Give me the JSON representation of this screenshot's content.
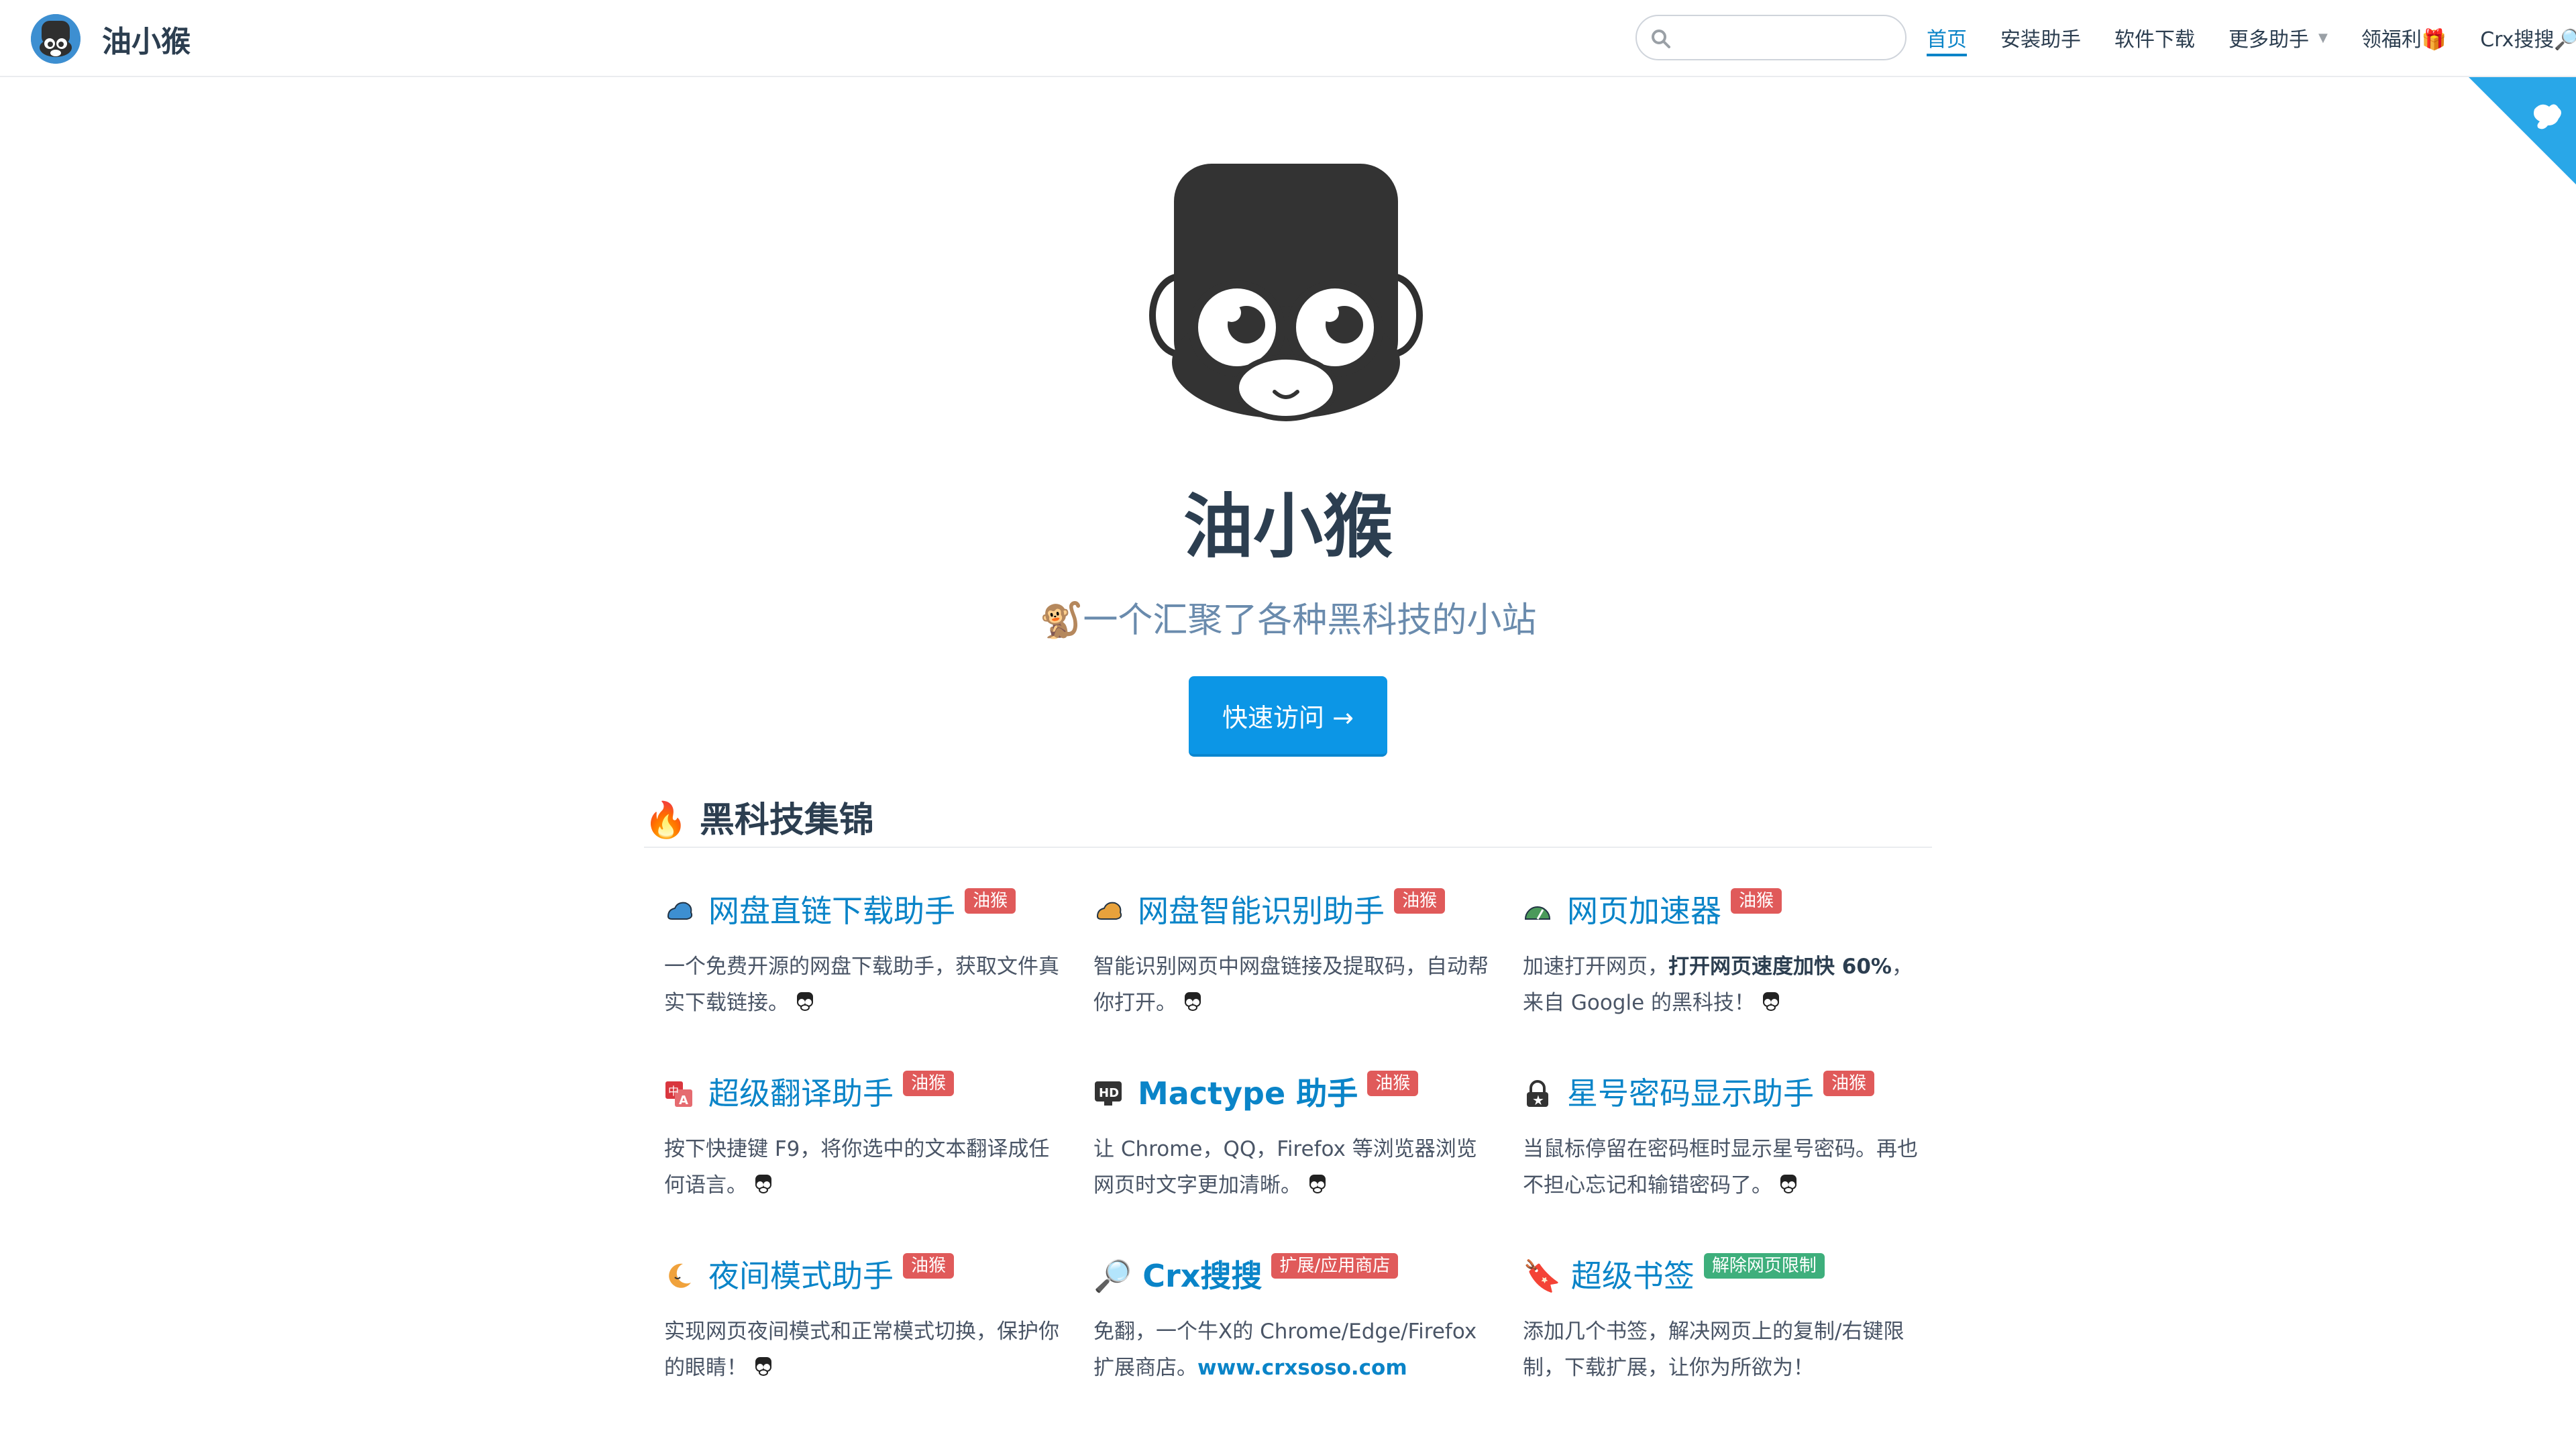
{
  "navbar": {
    "brand_title": "油小猴",
    "search": {
      "placeholder": "",
      "value": ""
    },
    "links": [
      {
        "label": "首页",
        "active": true
      },
      {
        "label": "安装助手"
      },
      {
        "label": "软件下载"
      },
      {
        "label": "更多助手",
        "dropdown": true
      },
      {
        "label": "领福利🎁"
      },
      {
        "label": "Crx搜搜🔎",
        "external": true
      }
    ]
  },
  "hero": {
    "title": "油小猴",
    "description": "🐒一个汇聚了各种黑科技的小站",
    "button_label": "快速访问 →"
  },
  "section": {
    "title": "🔥 黑科技集锦"
  },
  "cards": [
    {
      "icon": "cloud-blue-icon",
      "title": "网盘直链下载助手",
      "badge": "油猴",
      "desc": "一个免费开源的网盘下载助手，获取文件真实下载链接。"
    },
    {
      "icon": "cloud-orange-icon",
      "title": "网盘智能识别助手",
      "badge": "油猴",
      "desc": "智能识别网页中网盘链接及提取码，自动帮你打开。"
    },
    {
      "icon": "speedometer-icon",
      "title": "网页加速器",
      "badge": "油猴",
      "desc_prefix": "加速打开网页，",
      "desc_bold": "打开网页速度加快 60%",
      "desc_suffix": "，来自 Google 的黑科技！"
    },
    {
      "icon": "translate-icon",
      "title": "超级翻译助手",
      "badge": "油猴",
      "desc": "按下快捷键 F9，将你选中的文本翻译成任何语言。"
    },
    {
      "icon": "hd-icon",
      "title": "Mactype 助手",
      "badge": "油猴",
      "desc": "让 Chrome，QQ，Firefox 等浏览器浏览网页时文字更加清晰。"
    },
    {
      "icon": "lock-star-icon",
      "title": "星号密码显示助手",
      "badge": "油猴",
      "desc": "当鼠标停留在密码框时显示星号密码。再也不担心忘记和输错密码了。"
    },
    {
      "icon": "moon-icon",
      "title": "夜间模式助手",
      "badge": "油猴",
      "desc": "实现网页夜间模式和正常模式切换，保护你的眼睛！"
    },
    {
      "icon": "magnifier-icon",
      "title": "🔎 Crx搜搜",
      "badge": "扩展/应用商店",
      "desc_prefix": "免翻，一个牛X的 Chrome/Edge/Firefox 扩展商店。",
      "desc_link": "www.crxsoso.com"
    },
    {
      "icon": "bookmark-icon",
      "title": "🔖 超级书签",
      "badge": "解除网页限制",
      "desc": "添加几个书签，解决网页上的复制/右键限制，下载扩展，让你为所欲为！"
    }
  ],
  "colors": {
    "accent": "#0a84c8",
    "button": "#0c96e6",
    "badge_red": "#e05a5a",
    "badge_green": "#3eaf7c",
    "corner": "#29a7e8"
  }
}
